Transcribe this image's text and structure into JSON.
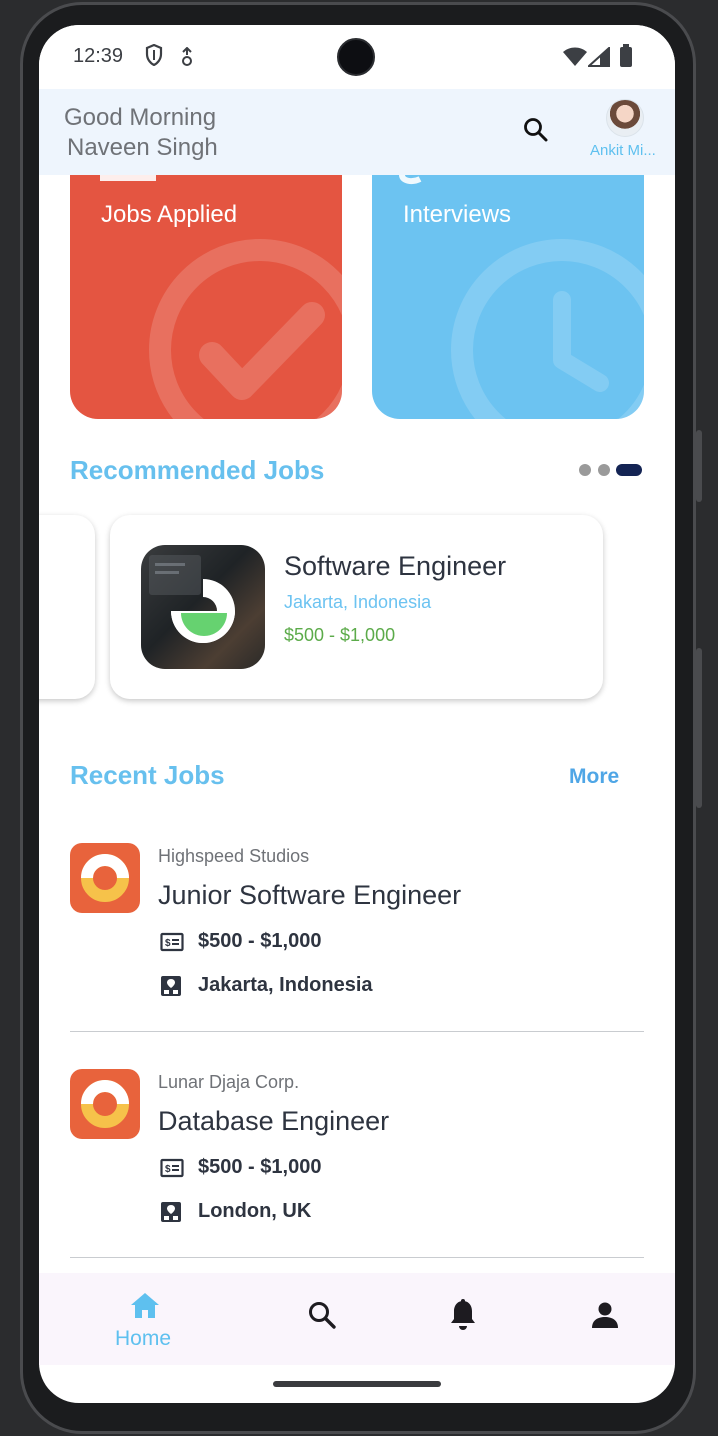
{
  "status_bar": {
    "time": "12:39"
  },
  "header": {
    "greeting": "Good Morning",
    "user_name": "Naveen Singh",
    "profile_name": "Ankit Mi..."
  },
  "stats": [
    {
      "label": "Jobs Applied",
      "color": "#e45541",
      "icon": "check-icon"
    },
    {
      "label": "Interviews",
      "color": "#6cc3f1",
      "icon": "clock-icon"
    }
  ],
  "recommended": {
    "title": "Recommended Jobs",
    "card": {
      "title": "Software Engineer",
      "location": "Jakarta, Indonesia",
      "salary": "$500 - $1,000"
    },
    "page_count": 3,
    "active_page": 3
  },
  "recent": {
    "title": "Recent Jobs",
    "more_label": "More",
    "jobs": [
      {
        "company": "Highspeed Studios",
        "title": "Junior Software Engineer",
        "salary": "$500 - $1,000",
        "location": "Jakarta, Indonesia"
      },
      {
        "company": "Lunar Djaja Corp.",
        "title": "Database Engineer",
        "salary": "$500 - $1,000",
        "location": "London, UK"
      }
    ]
  },
  "bottom_nav": {
    "items": [
      {
        "label": "Home",
        "icon": "home-icon",
        "active": true
      },
      {
        "label": "",
        "icon": "search-icon",
        "active": false
      },
      {
        "label": "",
        "icon": "bell-icon",
        "active": false
      },
      {
        "label": "",
        "icon": "person-icon",
        "active": false
      }
    ]
  },
  "colors": {
    "accent": "#67c0ee",
    "jobs_applied": "#e45541",
    "interviews": "#6cc3f1",
    "salary": "#5cab4a",
    "company_logo": "#e8633c"
  }
}
